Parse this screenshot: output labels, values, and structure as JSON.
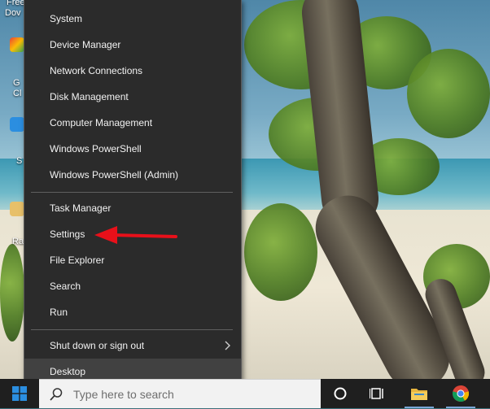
{
  "desktop": {
    "icon_labels": [
      "Free",
      "Dov",
      "G",
      "Cl",
      "S",
      "Ra"
    ]
  },
  "menu": {
    "group1": [
      "System",
      "Device Manager",
      "Network Connections",
      "Disk Management",
      "Computer Management",
      "Windows PowerShell",
      "Windows PowerShell (Admin)"
    ],
    "group2": [
      "Task Manager",
      "Settings",
      "File Explorer",
      "Search",
      "Run"
    ],
    "group3": [
      "Shut down or sign out",
      "Desktop"
    ]
  },
  "taskbar": {
    "search_placeholder": "Type here to search",
    "pinned_apps": [
      "task-view",
      "file-explorer",
      "chrome"
    ]
  },
  "annotation": {
    "color": "#e8101a",
    "points_to": "Settings"
  },
  "colors": {
    "menu_bg": "#2b2b2b",
    "menu_text": "#f2f2f2",
    "taskbar_bg": "#1f1f1f",
    "start_blue": "#2b8ee0"
  }
}
